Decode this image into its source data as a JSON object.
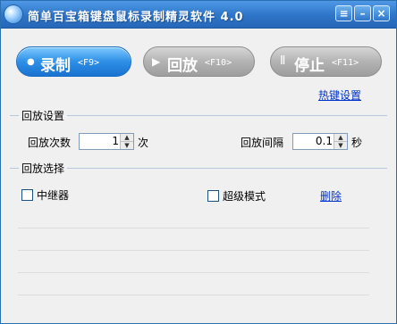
{
  "titlebar": {
    "title": "简单百宝箱键盘鼠标录制精灵软件 4.0",
    "menu_icon": "≡",
    "min_icon": "–",
    "close_icon": "×"
  },
  "buttons": {
    "record": {
      "label": "录制",
      "key": "<F9>",
      "glyph": "●"
    },
    "play": {
      "label": "回放",
      "key": "<F10>",
      "glyph": "▶"
    },
    "stop": {
      "label": "停止",
      "key": "<F11>",
      "glyph": "Ⅱ"
    }
  },
  "hotkey_link": "热键设置",
  "playback_settings": {
    "legend": "回放设置",
    "count_label": "回放次数",
    "count_value": "1",
    "count_unit": "次",
    "interval_label": "回放间隔",
    "interval_value": "0.1",
    "interval_unit": "秒",
    "up_arrow": "▲",
    "down_arrow": "▼"
  },
  "playback_selection": {
    "legend": "回放选择",
    "relay_label": "中继器",
    "super_mode_label": "超级模式",
    "delete_label": "删除"
  },
  "colors": {
    "titlebar": "#2e74c7",
    "record_button": "#2e8fe6",
    "disabled_button": "#b3b3b3",
    "link": "#0033cc"
  }
}
